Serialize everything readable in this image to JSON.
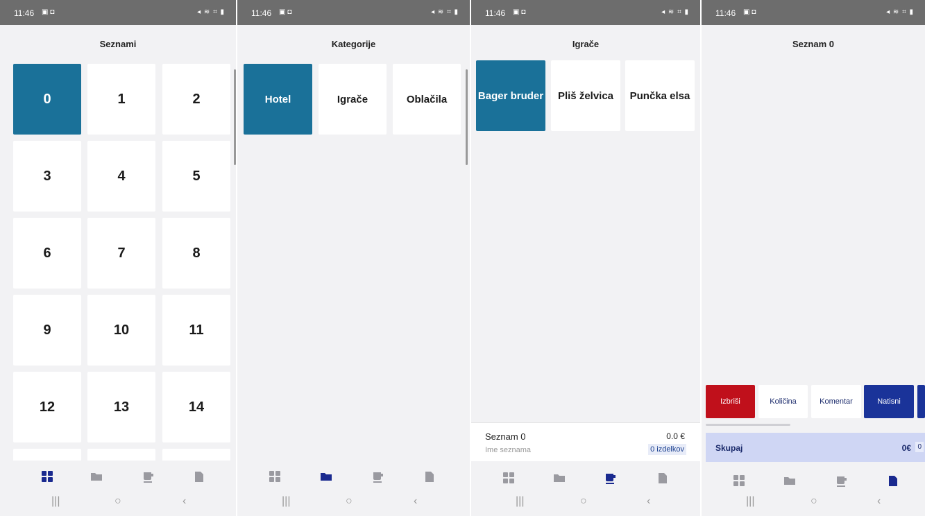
{
  "status": {
    "time": "11:46",
    "icons": "◂ ≋ ⌗ ▮"
  },
  "screens": [
    {
      "title": "Seznami",
      "tiles": [
        "0",
        "1",
        "2",
        "3",
        "4",
        "5",
        "6",
        "7",
        "8",
        "9",
        "10",
        "11",
        "12",
        "13",
        "14"
      ],
      "selected": "0"
    },
    {
      "title": "Kategorije",
      "tiles": [
        "Hotel",
        "Igrače",
        "Oblačila"
      ],
      "selected": "Hotel"
    },
    {
      "title": "Igrače",
      "tiles": [
        "Bager bruder",
        "Pliš želvica",
        "Punčka elsa"
      ],
      "selected": "Bager bruder",
      "summary": {
        "name": "Seznam 0",
        "placeholder": "Ime seznama",
        "price": "0.0 €",
        "count": "0 izdelkov"
      }
    },
    {
      "title": "Seznam 0",
      "actions": [
        "Izbriši",
        "Količina",
        "Komentar",
        "Natisni"
      ],
      "total": {
        "label": "Skupaj",
        "amount": "0€",
        "count": "0"
      }
    }
  ],
  "nav_icons": [
    "grid-icon",
    "folder-icon",
    "cup-icon",
    "document-icon"
  ],
  "sysnav": [
    "|||",
    "○",
    "‹"
  ],
  "colors": {
    "selected": "#1a7199",
    "nav_active": "#1a2a8f",
    "nav_inactive": "#9a9aa0",
    "delete": "#c0101b",
    "print": "#1a3399"
  }
}
